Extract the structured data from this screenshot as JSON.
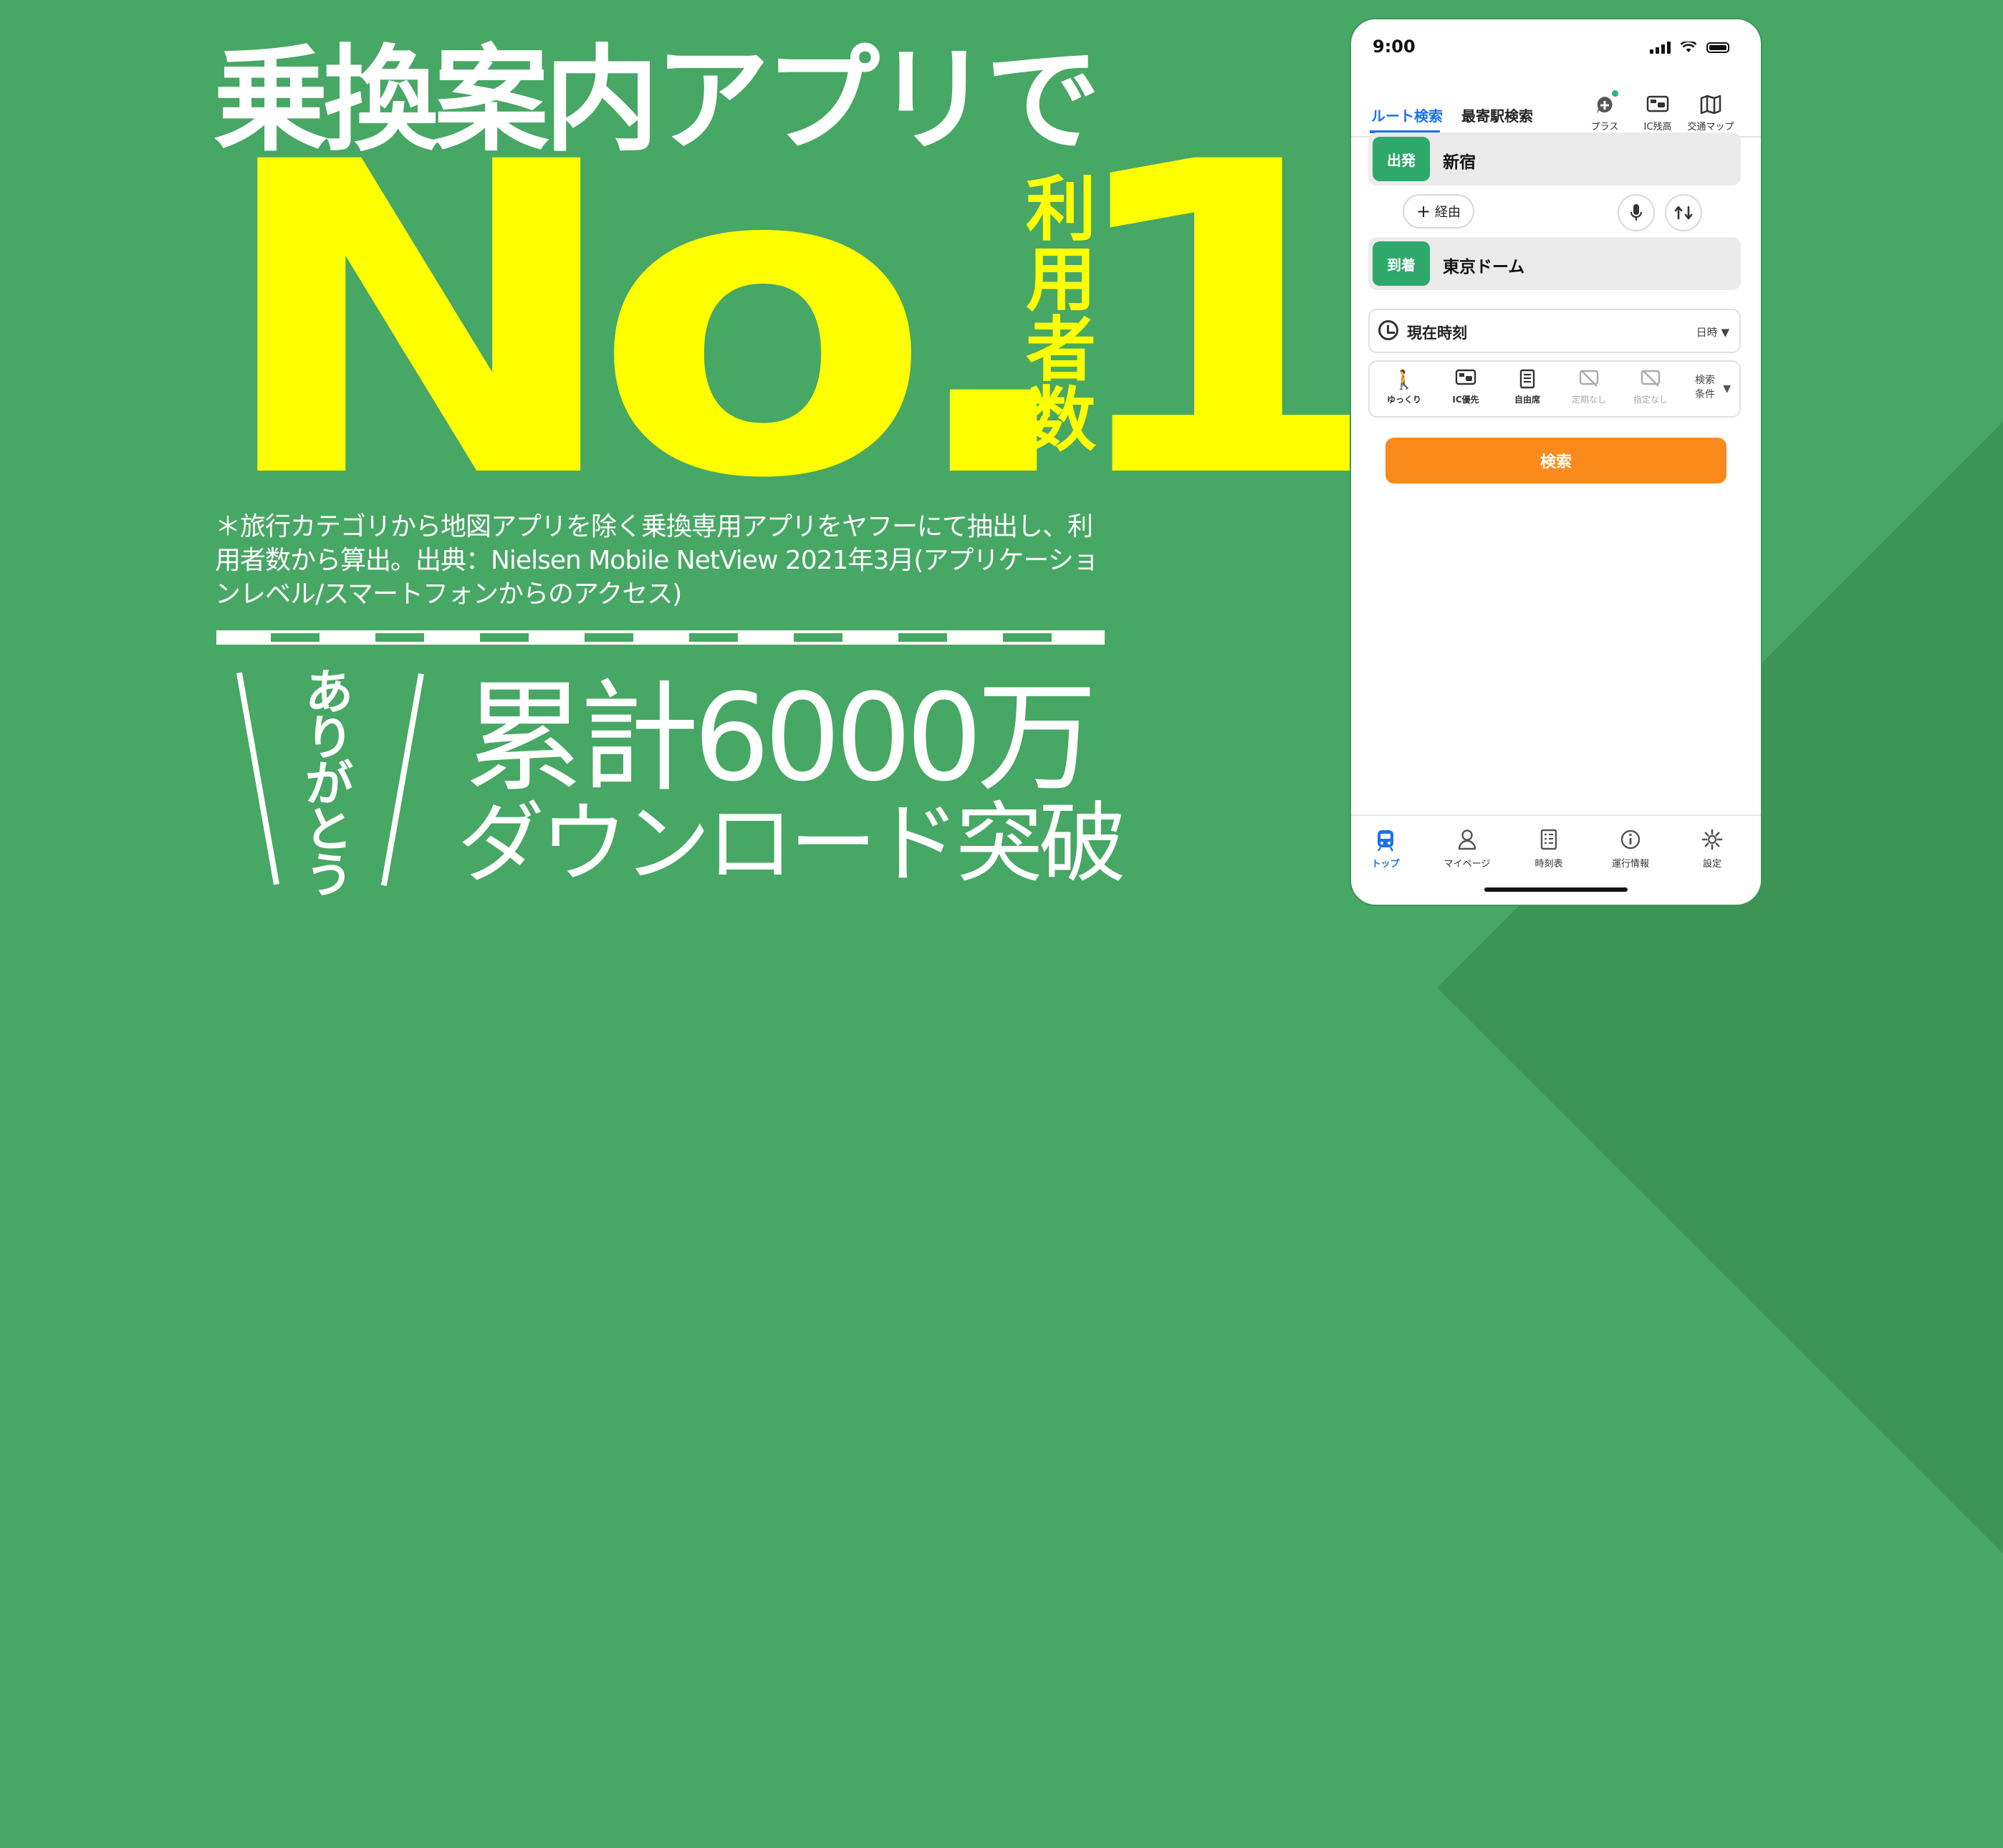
{
  "promo": {
    "headline": "乗換案内アプリで",
    "rank": "No.1",
    "rank_suffix": "利用者数",
    "footnote": "＊旅行カテゴリから地図アプリを除く乗換専用アプリをヤフーにて抽出し、利用者数から算出。出典：Nielsen Mobile NetView 2021年3月(アプリケーションレベル/スマートフォンからのアクセス)",
    "thanks": "ありがとう",
    "downloads_line1": "累計6000万",
    "downloads_line2": "ダウンロード突破"
  },
  "colors": {
    "background": "#47a764",
    "rank_yellow": "#ffff00",
    "accent_blue": "#1a73e8",
    "badge_green": "#2ea86b",
    "search_orange": "#fb8a1c"
  },
  "status_bar": {
    "time": "9:00"
  },
  "header": {
    "tab_route": "ルート検索",
    "tab_nearest": "最寄駅検索",
    "icons": [
      {
        "icon": "plus-chat-icon",
        "label": "プラス"
      },
      {
        "icon": "ic-card-icon",
        "label": "IC残高"
      },
      {
        "icon": "map-icon",
        "label": "交通マップ"
      }
    ]
  },
  "route": {
    "from_badge": "出発",
    "from_value": "新宿",
    "via_label": "経由",
    "to_badge": "到着",
    "to_value": "東京ドーム"
  },
  "time": {
    "label": "現在時刻",
    "selector": "日時"
  },
  "options": [
    {
      "icon": "walk-icon",
      "label": "ゆっくり"
    },
    {
      "icon": "ic-priority-icon",
      "label": "IC優先"
    },
    {
      "icon": "seat-icon",
      "label": "自由席"
    },
    {
      "icon": "pass-off-icon",
      "label": "定期なし"
    },
    {
      "icon": "reserved-off-icon",
      "label": "指定なし"
    }
  ],
  "search_conditions": "検索\n条件",
  "search_button": "検索",
  "bottom_nav": [
    {
      "icon": "train-icon",
      "label": "トップ"
    },
    {
      "icon": "person-icon",
      "label": "マイページ"
    },
    {
      "icon": "timetable-icon",
      "label": "時刻表"
    },
    {
      "icon": "info-icon",
      "label": "運行情報"
    },
    {
      "icon": "gear-icon",
      "label": "設定"
    }
  ]
}
